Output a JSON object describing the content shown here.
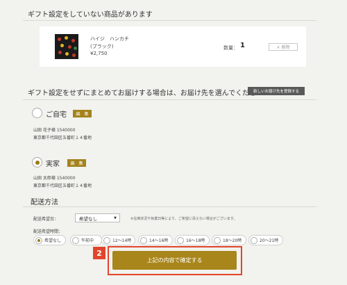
{
  "no_gift": {
    "title": "ギフト設定をしていない商品があります"
  },
  "product": {
    "name_line1": "ハイジ　ハンカチ",
    "name_line2": "(ブラック)",
    "price": "¥2,750",
    "quantity_label": "数量：",
    "quantity": "1",
    "delete_label": "× 削除"
  },
  "delivery": {
    "title": "ギフト設定をせずにまとめてお届けする場合は、お届け先を選んでください",
    "new_address_button": "新しいお届け先を登録する",
    "addresses": [
      {
        "name": "ご自宅",
        "edit_label": "編　集",
        "line1": "山田 花子様 1540000",
        "line2": "東京都千代田区五番町１４番地",
        "checked": false
      },
      {
        "name": "実家",
        "edit_label": "編　集",
        "line1": "山田 太郎様 1540000",
        "line2": "東京都千代田区五番町１４番地",
        "checked": true
      }
    ]
  },
  "shipping": {
    "title": "配送方法",
    "date_label": "配送希望日：",
    "date_value": "希望なし",
    "date_note": "※在庫状況や休業日等により、ご希望に添えない場合がございます。",
    "time_label": "配送希望時間：",
    "time_options": [
      "希望なし",
      "午前中",
      "12〜14時",
      "14〜16時",
      "16〜18時",
      "18〜20時",
      "20〜21時"
    ],
    "time_selected": "希望なし"
  },
  "confirm": {
    "step_number": "2",
    "button_label": "上記の内容で確定する"
  },
  "colors": {
    "accent_gold": "#a8861b",
    "highlight_red": "#e2452b",
    "dark_button": "#595959",
    "background": "#f2f2ee"
  }
}
